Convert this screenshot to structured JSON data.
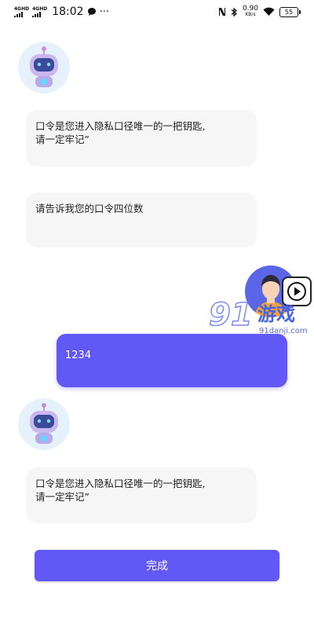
{
  "status_bar": {
    "signal1_label": "4GHD",
    "signal2_label": "4GHD",
    "time": "18:02",
    "more": "···",
    "speed_value": "0.90",
    "speed_unit": "KB/s",
    "battery": "55",
    "icons": [
      "chat-icon",
      "nfc-icon",
      "bluetooth-icon",
      "wifi-icon"
    ]
  },
  "messages": [
    {
      "sender": "bot",
      "text": "口令是您进入隐私口径唯一的一把钥匙,\n请一定牢记”"
    },
    {
      "sender": "bot",
      "text": "请告诉我您的口令四位数"
    },
    {
      "sender": "user",
      "text": "1234"
    },
    {
      "sender": "bot",
      "text": "口令是您进入隐私口径唯一的一把钥匙,\n请一定牢记”"
    }
  ],
  "watermark": {
    "brand": "游戏",
    "number": "91",
    "site": "91danji.com"
  },
  "done_button": "完成",
  "colors": {
    "accent": "#6158f6",
    "bubble_bg": "#f6f6f6",
    "avatar_bg": "#e6f2fb"
  }
}
